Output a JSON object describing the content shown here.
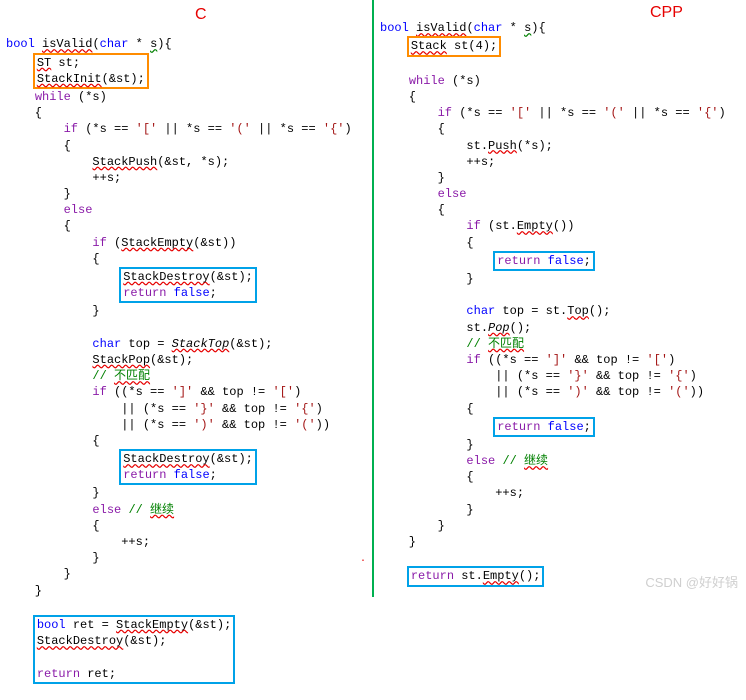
{
  "labels": {
    "c": "C",
    "cpp": "CPP"
  },
  "c": {
    "sig_open": "bool isValid(char * s){",
    "init1": "ST st;",
    "init2": "StackInit(&st);",
    "while": "while (*s)",
    "ob": "{",
    "cb": "}",
    "if_open": "if (*s == '[' || *s == '(' || *s == '{')",
    "push": "StackPush(&st, *s);",
    "inc": "++s;",
    "else": "else",
    "if_empty": "if (StackEmpty(&st))",
    "destroy": "StackDestroy(&st);",
    "ret_false": "return false;",
    "top_decl": "char top = StackTop(&st);",
    "pop": "StackPop(&st);",
    "cmt_nomatch": "// 不匹配",
    "if_match1": "if ((*s == ']' && top != '[')",
    "if_match2": "|| (*s == '}' && top != '{')",
    "if_match3": "|| (*s == ')' && top != '('))",
    "else_cont": "else // 继续",
    "ret_decl": "bool ret = StackEmpty(&st);",
    "ret_ret": "return ret;"
  },
  "cpp": {
    "sig_open": "bool isValid(char * s){",
    "init": "Stack st(4);",
    "while": "while (*s)",
    "ob": "{",
    "cb": "}",
    "if_open": "if (*s == '[' || *s == '(' || *s == '{')",
    "push": "st.Push(*s);",
    "inc": "++s;",
    "else": "else",
    "if_empty": "if (st.Empty())",
    "ret_false": "return false;",
    "top_decl": "char top = st.Top();",
    "pop": "st.Pop();",
    "cmt_nomatch": "// 不匹配",
    "if_match1": "if ((*s == ']' && top != '[')",
    "if_match2": "|| (*s == '}' && top != '{')",
    "if_match3": "|| (*s == ')' && top != '('))",
    "else_cont": "else // 继续",
    "ret_empty": "return st.Empty();"
  },
  "watermark": "CSDN @好好锅"
}
